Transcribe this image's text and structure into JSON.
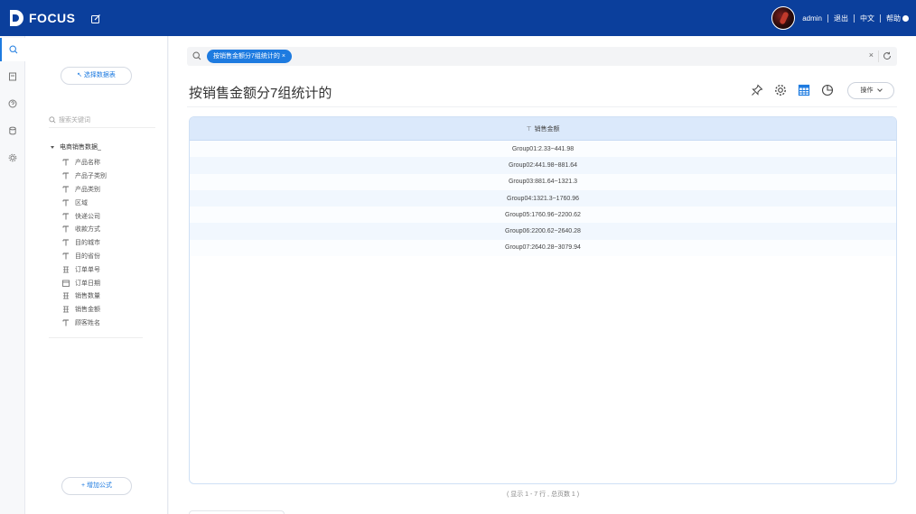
{
  "topbar": {
    "brand": "FOCUS",
    "user": "admin",
    "logout": "退出",
    "language": "中文",
    "help": "帮助"
  },
  "left_panel": {
    "select_table_label": "选择数据表",
    "search_placeholder": "搜索关键词",
    "table_name": "电商销售数据_",
    "fields": [
      {
        "label": "产品名称",
        "icon": "text-field-icon"
      },
      {
        "label": "产品子类别",
        "icon": "text-field-icon"
      },
      {
        "label": "产品类别",
        "icon": "text-field-icon"
      },
      {
        "label": "区域",
        "icon": "text-field-icon"
      },
      {
        "label": "快递公司",
        "icon": "text-field-icon"
      },
      {
        "label": "收款方式",
        "icon": "text-field-icon"
      },
      {
        "label": "目的城市",
        "icon": "text-field-icon"
      },
      {
        "label": "目的省份",
        "icon": "text-field-icon"
      },
      {
        "label": "订单单号",
        "icon": "number-field-icon"
      },
      {
        "label": "订单日期",
        "icon": "date-field-icon"
      },
      {
        "label": "销售数量",
        "icon": "number-field-icon"
      },
      {
        "label": "销售金额",
        "icon": "number-field-icon"
      },
      {
        "label": "顾客姓名",
        "icon": "text-field-icon"
      }
    ],
    "add_formula_label": "增加公式"
  },
  "main": {
    "search_chip": "按销售金额分7组统计的",
    "clear_symbol": "×",
    "title": "按销售金额分7组统计的",
    "operate_label": "操作",
    "table": {
      "header": "销售金额",
      "rows": [
        "Group01:2.33~441.98",
        "Group02:441.98~881.64",
        "Group03:881.64~1321.3",
        "Group04:1321.3~1760.96",
        "Group05:1760.96~2200.62",
        "Group06:2200.62~2640.28",
        "Group07:2640.28~3079.94"
      ]
    },
    "footer": "( 显示 1 - 7 行 , 总页数 1 )"
  },
  "colors": {
    "topbar": "#0b3f9c",
    "accent": "#1e7be0",
    "table_header": "#dbe9fb"
  }
}
